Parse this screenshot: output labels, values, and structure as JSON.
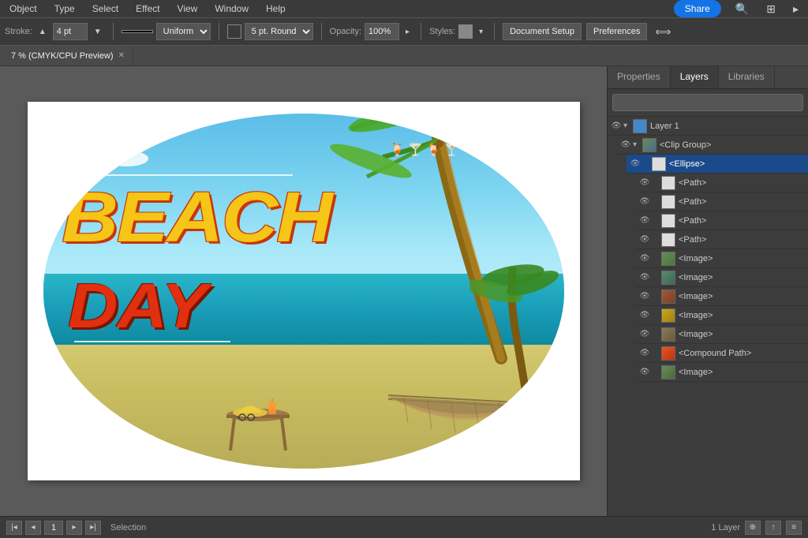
{
  "menubar": {
    "items": [
      "Object",
      "Type",
      "Select",
      "Effect",
      "View",
      "Window",
      "Help"
    ]
  },
  "toolbar": {
    "stroke_label": "Stroke:",
    "stroke_value": "4 pt",
    "stroke_type": "Uniform",
    "brush_label": "5 pt. Round",
    "opacity_label": "Opacity:",
    "opacity_value": "100%",
    "styles_label": "Styles:",
    "doc_setup": "Document Setup",
    "preferences": "Preferences",
    "share": "Share"
  },
  "tabbar": {
    "tab_label": "7 % (CMYK/CPU Preview)"
  },
  "canvas": {
    "title": "Beach Day",
    "text_beach": "BEACH",
    "text_day": "DAY"
  },
  "rightpanel": {
    "tabs": [
      "Properties",
      "Layers",
      "Libraries"
    ],
    "active_tab": "Layers",
    "search_placeholder": "",
    "layers": [
      {
        "id": "layer1",
        "label": "Layer 1",
        "indent": 0,
        "type": "layer",
        "expanded": true,
        "visible": true
      },
      {
        "id": "clipgroup",
        "label": "<Clip Group>",
        "indent": 1,
        "type": "group",
        "expanded": true,
        "visible": true
      },
      {
        "id": "ellipse",
        "label": "<Ellipse>",
        "indent": 2,
        "type": "shape",
        "visible": true,
        "selected": true
      },
      {
        "id": "path1",
        "label": "<Path>",
        "indent": 3,
        "type": "path",
        "visible": true
      },
      {
        "id": "path2",
        "label": "<Path>",
        "indent": 3,
        "type": "path",
        "visible": true
      },
      {
        "id": "path3",
        "label": "<Path>",
        "indent": 3,
        "type": "path",
        "visible": true
      },
      {
        "id": "path4",
        "label": "<Path>",
        "indent": 3,
        "type": "path",
        "visible": true
      },
      {
        "id": "image1",
        "label": "<Image>",
        "indent": 3,
        "type": "image",
        "visible": true
      },
      {
        "id": "image2",
        "label": "<Image>",
        "indent": 3,
        "type": "image",
        "visible": true
      },
      {
        "id": "image3",
        "label": "<Image>",
        "indent": 3,
        "type": "image",
        "visible": true
      },
      {
        "id": "image4",
        "label": "<Image>",
        "indent": 3,
        "type": "image",
        "visible": true
      },
      {
        "id": "image5",
        "label": "<Image>",
        "indent": 3,
        "type": "image",
        "visible": true
      },
      {
        "id": "compound",
        "label": "<Compound Path>",
        "indent": 3,
        "type": "compound",
        "visible": true
      },
      {
        "id": "image6",
        "label": "<Image>",
        "indent": 3,
        "type": "image",
        "visible": true
      }
    ]
  },
  "statusbar": {
    "page": "1",
    "mode": "Selection",
    "layers_count": "1 Layer",
    "icons": [
      "new-layer-icon",
      "export-icon",
      "panel-icon"
    ]
  }
}
